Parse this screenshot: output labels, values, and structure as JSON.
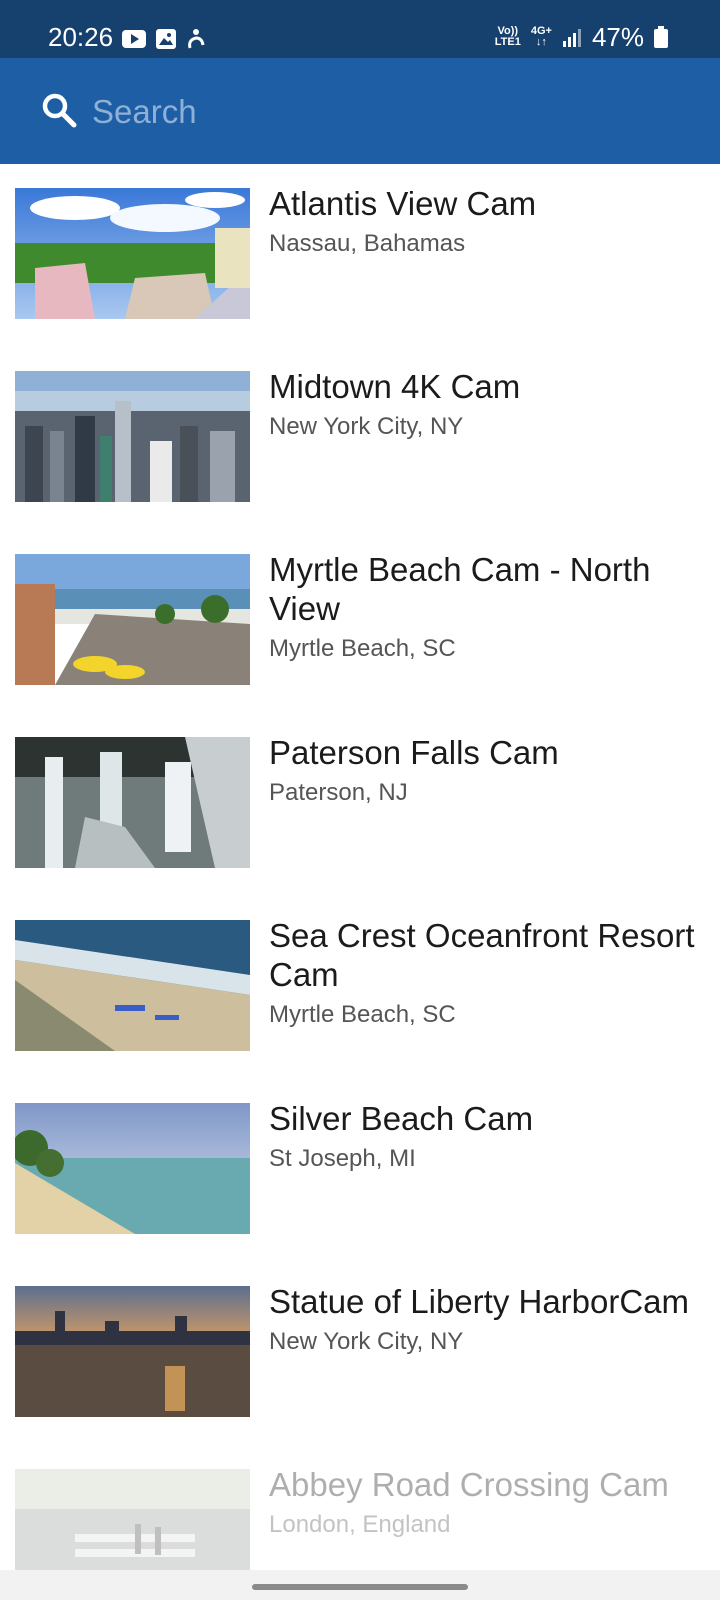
{
  "status_bar": {
    "time": "20:26",
    "left_icons": [
      "youtube-icon",
      "gallery-icon",
      "accessibility-icon"
    ],
    "volte_label": "Vo))",
    "lte_label": "LTE1",
    "network_label": "4G+",
    "battery_percent": "47%"
  },
  "search": {
    "placeholder": "Search",
    "value": ""
  },
  "cams": [
    {
      "title": "Atlantis View Cam",
      "location": "Nassau, Bahamas"
    },
    {
      "title": "Midtown 4K Cam",
      "location": "New York City, NY"
    },
    {
      "title": "Myrtle Beach Cam - North View",
      "location": "Myrtle Beach, SC"
    },
    {
      "title": "Paterson Falls Cam",
      "location": "Paterson, NJ"
    },
    {
      "title": "Sea Crest Oceanfront Resort Cam",
      "location": "Myrtle Beach, SC"
    },
    {
      "title": "Silver Beach Cam",
      "location": "St Joseph, MI"
    },
    {
      "title": "Statue of Liberty HarborCam",
      "location": "New York City, NY"
    },
    {
      "title": "Abbey Road Crossing Cam",
      "location": "London, England"
    }
  ],
  "colors": {
    "status_bar": "#16406e",
    "app_bar": "#1d5ea5",
    "title_text": "#1b1b1b",
    "subtitle_text": "#555555"
  }
}
